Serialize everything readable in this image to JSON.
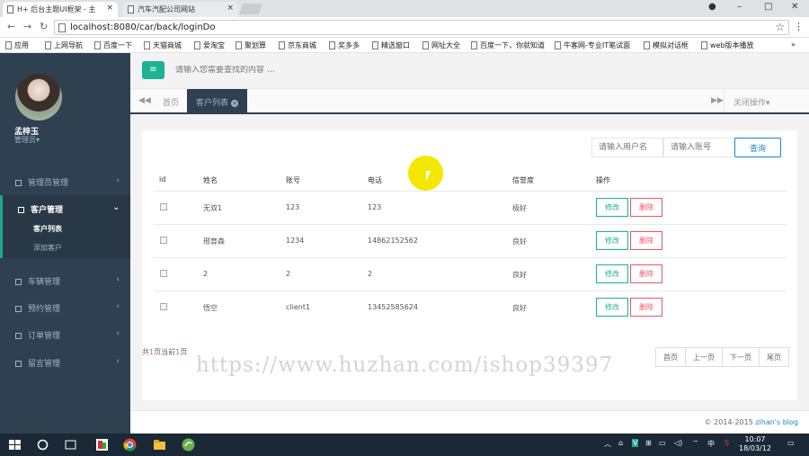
{
  "browser": {
    "tabs": [
      {
        "title": "H+ 后台主题UI框架 - 主"
      },
      {
        "title": "汽车汽配公司网站"
      }
    ],
    "url": "localhost:8080/car/back/loginDo",
    "bookmarks": [
      "应用",
      "上网导航",
      "百度一下",
      "天猫商城",
      "爱淘宝",
      "聚划算",
      "京东商城",
      "奖多多",
      "精选窗口",
      "网址大全",
      "百度一下，你就知道",
      "牛客网-专业IT笔试面",
      "模拟对话框",
      "web版本播放"
    ]
  },
  "sidebar": {
    "user_name": "孟梓玉",
    "user_role": "管理员▾",
    "menu": [
      {
        "label": "管理员管理"
      },
      {
        "label": "客户管理",
        "children": [
          {
            "label": "客户列表"
          },
          {
            "label": "添加客户"
          }
        ]
      },
      {
        "label": "车辆管理"
      },
      {
        "label": "预约管理"
      },
      {
        "label": "订单管理"
      },
      {
        "label": "留言管理"
      }
    ]
  },
  "topbar": {
    "search_placeholder": "请输入您需要查找的内容 …"
  },
  "content_tabs": {
    "home": "首页",
    "active": "客户列表",
    "close_ops": "关闭操作▾"
  },
  "filter": {
    "username_placeholder": "请输入用户名",
    "account_placeholder": "请输入账号",
    "query_label": "查询"
  },
  "table": {
    "headers": [
      "id",
      "姓名",
      "账号",
      "电话",
      "信誉度",
      "操作"
    ],
    "rows": [
      {
        "name": "无双1",
        "account": "123",
        "phone": "123",
        "credit": "极好"
      },
      {
        "name": "邢育森",
        "account": "1234",
        "phone": "14862152562",
        "credit": "良好"
      },
      {
        "name": "2",
        "account": "2",
        "phone": "2",
        "credit": "良好"
      },
      {
        "name": "悟空",
        "account": "client1",
        "phone": "13452585624",
        "credit": "良好"
      }
    ],
    "edit_label": "修改",
    "delete_label": "删除"
  },
  "pagination": {
    "info_prefix": "共",
    "total": "1",
    "mid": "页当前",
    "current": "1",
    "suffix": "页",
    "first": "首页",
    "prev": "上一页",
    "next": "下一页",
    "last": "尾页"
  },
  "footer": {
    "copyright": "© 2014-2015 ",
    "brand": "zihan's blog"
  },
  "watermark": "https://www.huzhan.com/ishop39397",
  "taskbar": {
    "time": "10:07",
    "date": "18/03/12"
  },
  "colors": {
    "sidebar": "#2f4050",
    "accent": "#1ab394",
    "danger": "#ed5565",
    "primary": "#1c84c6"
  }
}
